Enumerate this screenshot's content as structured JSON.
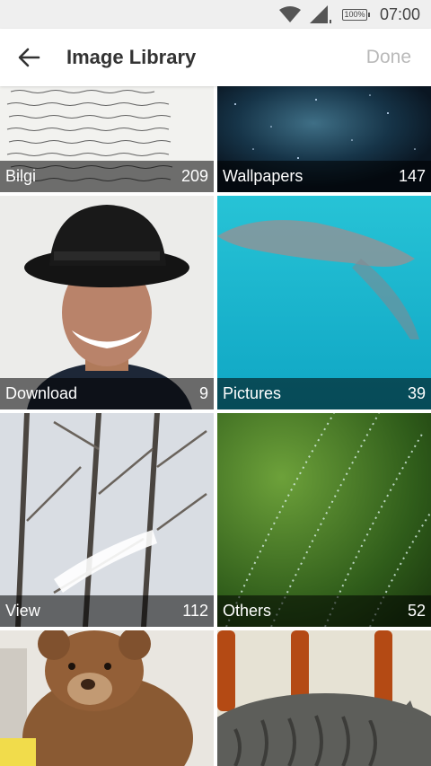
{
  "status_bar": {
    "battery": "100%",
    "time": "07:00",
    "icons": [
      "wifi-icon",
      "signal-icon",
      "battery-icon"
    ]
  },
  "app_bar": {
    "back_icon": "arrow-left-icon",
    "title": "Image Library",
    "done_label": "Done"
  },
  "albums": [
    {
      "name": "Bilgi",
      "count": "209"
    },
    {
      "name": "Wallpapers",
      "count": "147"
    },
    {
      "name": "Download",
      "count": "9"
    },
    {
      "name": "Pictures",
      "count": "39"
    },
    {
      "name": "View",
      "count": "112"
    },
    {
      "name": "Others",
      "count": "52"
    }
  ],
  "colors": {
    "app_bar_bg": "#ffffff",
    "title": "#333333",
    "done_disabled": "#b9b9b9",
    "caption_overlay": "rgba(0,0,0,0.55)"
  }
}
